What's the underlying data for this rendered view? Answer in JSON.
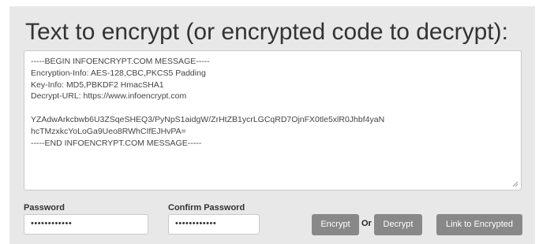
{
  "title": "Text to encrypt (or encrypted code to decrypt):",
  "message": {
    "lines": [
      "-----BEGIN INFOENCRYPT.COM MESSAGE-----",
      "Encryption-Info: AES-128,CBC,PKCS5 Padding",
      "Key-Info: MD5,PBKDF2 HmacSHA1",
      "Decrypt-URL: https://www.infoencrypt.com",
      "",
      "YZAdwArkcbwb6U3ZSqeSHEQ3/PyNpS1aidgW/ZrHtZB1ycrLGCqRD7OjnFX0tle5xlR0Jhbf4yaN",
      "hcTMzxkcYoLoGa9Ueo8RWhCIfEJHvPA=",
      "-----END INFOENCRYPT.COM MESSAGE-----"
    ]
  },
  "password": {
    "label": "Password",
    "value": "••••••••••••"
  },
  "confirm_password": {
    "label": "Confirm Password",
    "value": "••••••••••••"
  },
  "buttons": {
    "encrypt": "Encrypt",
    "or": "Or",
    "decrypt": "Decrypt",
    "link": "Link to Encrypted"
  },
  "colors": {
    "panel_bg": "#e8e8e8",
    "button_bg": "#888888",
    "button_text": "#ffffff"
  }
}
